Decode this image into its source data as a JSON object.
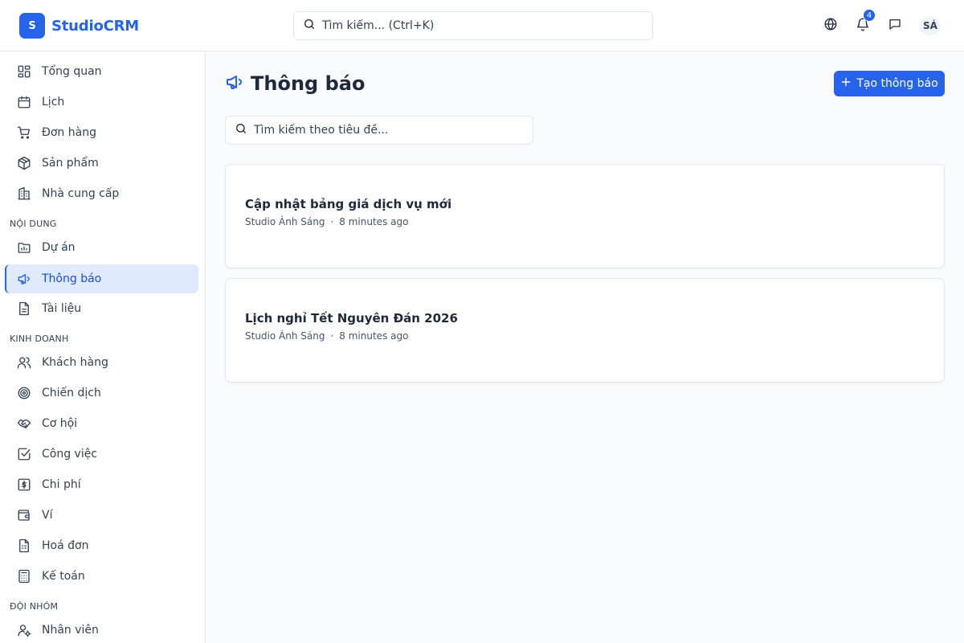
{
  "brand": {
    "mark": "S",
    "name": "StudioCRM",
    "accent": "#2563eb"
  },
  "header": {
    "search_placeholder": "Tìm kiếm... (Ctrl+K)",
    "notification_count": "4",
    "avatar_initials": "SÁ",
    "icons": [
      "globe-icon",
      "bell-icon",
      "message-icon"
    ]
  },
  "sidebar": {
    "items_top": [
      {
        "label": "Tổng quan",
        "icon": "dashboard-icon"
      },
      {
        "label": "Lịch",
        "icon": "calendar-icon"
      },
      {
        "label": "Đơn hàng",
        "icon": "cart-icon"
      },
      {
        "label": "Sản phẩm",
        "icon": "package-icon"
      },
      {
        "label": "Nhà cung cấp",
        "icon": "building-icon"
      }
    ],
    "section_content": "NỘI DUNG",
    "items_content": [
      {
        "label": "Dự án",
        "icon": "folder-chart-icon"
      },
      {
        "label": "Thông báo",
        "icon": "megaphone-icon",
        "active": true
      },
      {
        "label": "Tài liệu",
        "icon": "document-icon"
      }
    ],
    "section_business": "KINH DOANH",
    "items_business": [
      {
        "label": "Khách hàng",
        "icon": "users-icon"
      },
      {
        "label": "Chiến dịch",
        "icon": "target-icon"
      },
      {
        "label": "Cơ hội",
        "icon": "handshake-icon"
      },
      {
        "label": "Công việc",
        "icon": "checkbox-icon"
      },
      {
        "label": "Chi phí",
        "icon": "dollar-icon"
      },
      {
        "label": "Ví",
        "icon": "wallet-icon"
      },
      {
        "label": "Hoá đơn",
        "icon": "invoice-icon"
      },
      {
        "label": "Kế toán",
        "icon": "calculator-icon"
      }
    ],
    "section_team": "ĐỘI NHÓM",
    "items_team": [
      {
        "label": "Nhân viên",
        "icon": "user-cog-icon"
      }
    ]
  },
  "main": {
    "title": "Thông báo",
    "create_label": "Tạo thông báo",
    "search_placeholder": "Tìm kiếm theo tiêu đề...",
    "announcements": [
      {
        "title": "Cập nhật bảng giá dịch vụ mới",
        "author": "Studio Ánh Sáng",
        "time": "8 minutes ago"
      },
      {
        "title": "Lịch nghỉ Tết Nguyên Đán 2026",
        "author": "Studio Ánh Sáng",
        "time": "8 minutes ago"
      }
    ]
  }
}
